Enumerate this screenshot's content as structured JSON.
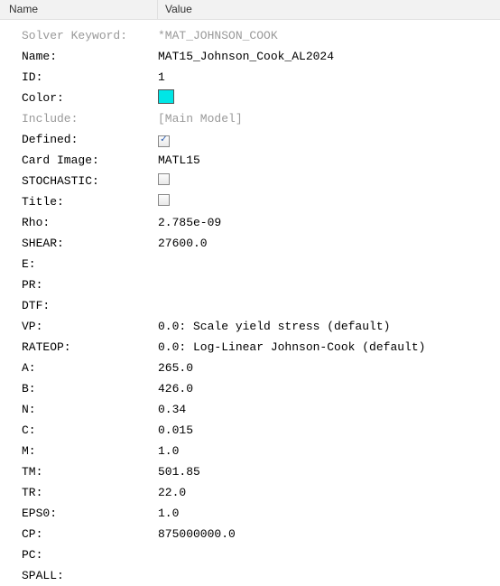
{
  "header": {
    "name": "Name",
    "value": "Value"
  },
  "rows": [
    {
      "label": "Solver Keyword:",
      "value": "*MAT_JOHNSON_COOK",
      "gray": true
    },
    {
      "label": "Name:",
      "value": "MAT15_Johnson_Cook_AL2024"
    },
    {
      "label": "ID:",
      "value": "1"
    },
    {
      "label": "Color:",
      "type": "color",
      "value": "#00e6e6"
    },
    {
      "label": "Include:",
      "value": "[Main Model]",
      "gray": true
    },
    {
      "label": "Defined:",
      "type": "checkbox",
      "checked": true
    },
    {
      "label": "Card Image:",
      "value": "MATL15"
    },
    {
      "label": "STOCHASTIC:",
      "type": "checkbox",
      "checked": false
    },
    {
      "label": "Title:",
      "type": "checkbox",
      "checked": false
    },
    {
      "label": "Rho:",
      "value": "2.785e-09"
    },
    {
      "label": "SHEAR:",
      "value": "27600.0"
    },
    {
      "label": "E:",
      "value": ""
    },
    {
      "label": "PR:",
      "value": ""
    },
    {
      "label": "DTF:",
      "value": ""
    },
    {
      "label": "VP:",
      "value": "0.0: Scale yield stress (default)"
    },
    {
      "label": "RATEOP:",
      "value": "0.0: Log-Linear Johnson-Cook (default)"
    },
    {
      "label": "A:",
      "value": "265.0"
    },
    {
      "label": "B:",
      "value": "426.0"
    },
    {
      "label": "N:",
      "value": "0.34"
    },
    {
      "label": "C:",
      "value": "0.015"
    },
    {
      "label": "M:",
      "value": "1.0"
    },
    {
      "label": "TM:",
      "value": "501.85"
    },
    {
      "label": "TR:",
      "value": "22.0"
    },
    {
      "label": "EPS0:",
      "value": "1.0"
    },
    {
      "label": "CP:",
      "value": "875000000.0"
    },
    {
      "label": "PC:",
      "value": ""
    },
    {
      "label": "SPALL:",
      "value": ""
    }
  ]
}
